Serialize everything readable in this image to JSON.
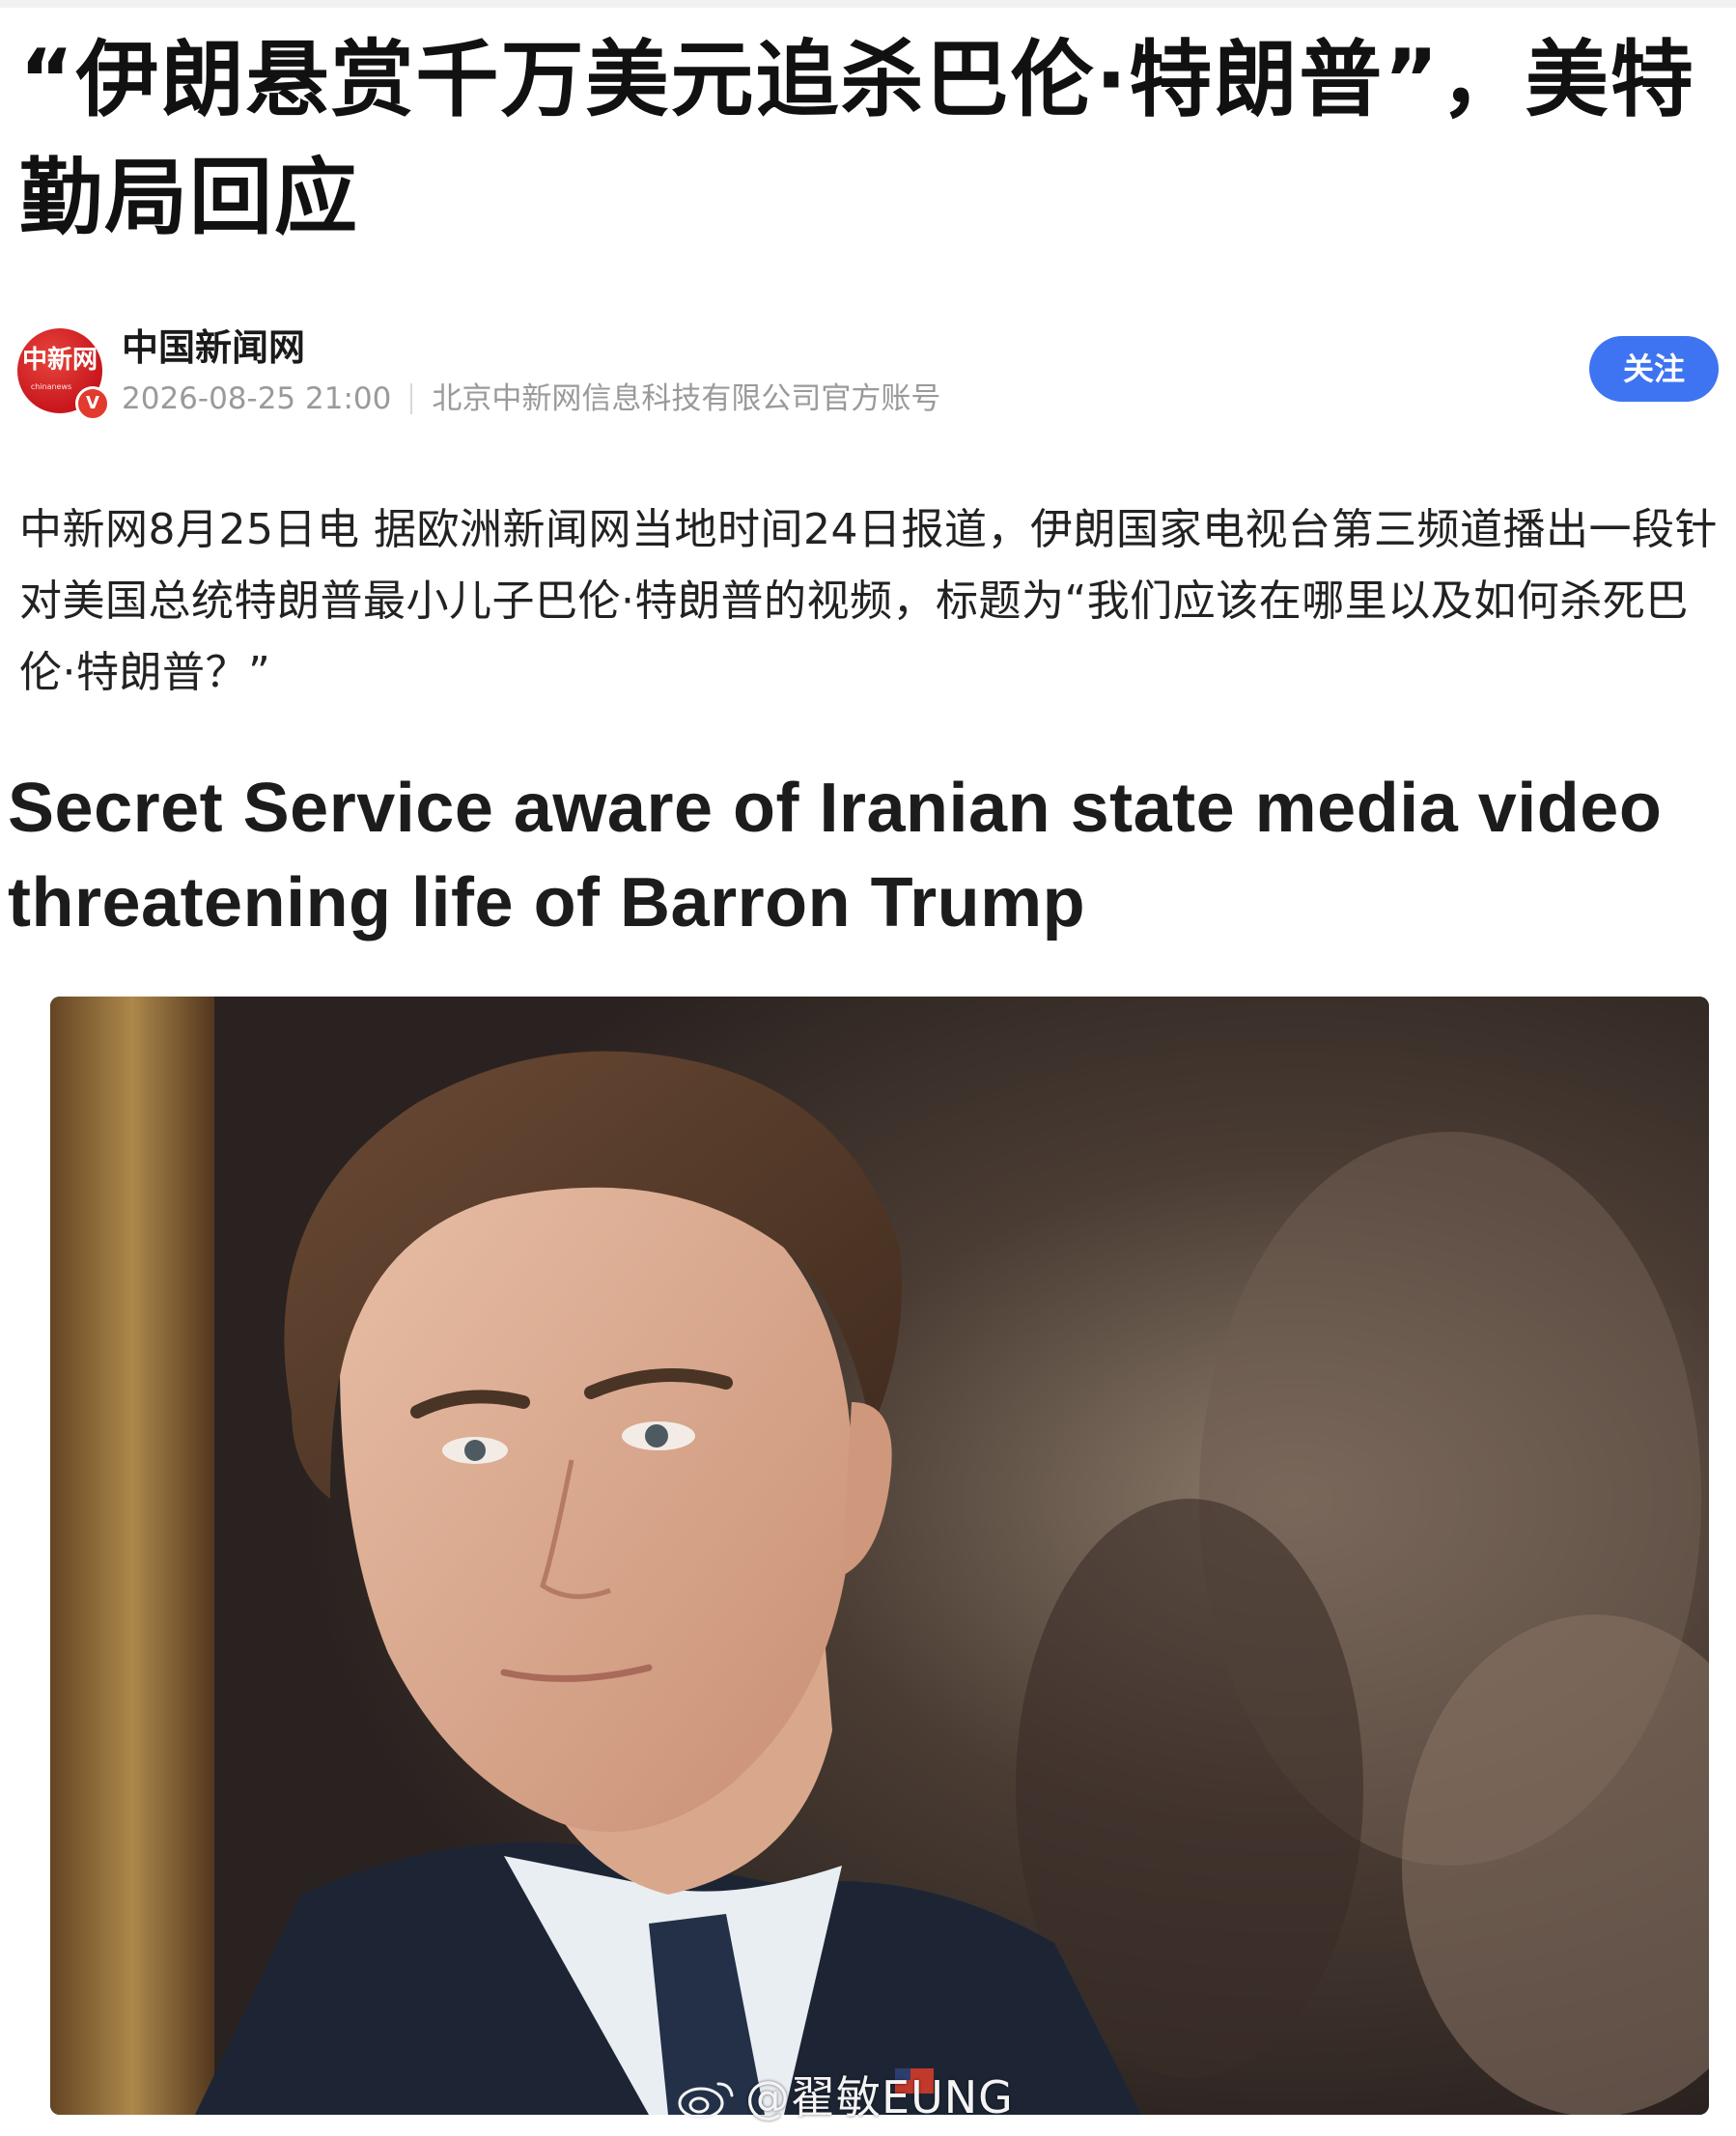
{
  "article": {
    "title": "“伊朗悬赏千万美元追杀巴伦·特朗普”，美特勤局回应",
    "body": "中新网8月25日电 据欧洲新闻网当地时间24日报道，伊朗国家电视台第三频道播出一段针对美国总统特朗普最小儿子巴伦·特朗普的视频，标题为“我们应该在哪里以及如何杀死巴伦·特朗普？”"
  },
  "author": {
    "name": "中国新闻网",
    "avatar_text": "中新网",
    "avatar_subtext": "chinanews",
    "verified_mark": "V",
    "timestamp": "2026-08-25 21:00",
    "description": "北京中新网信息科技有限公司官方账号",
    "follow_label": "关注"
  },
  "embedded_image": {
    "headline": "Secret Service aware of Iranian state media video threatening life of Barron Trump",
    "watermark": "@翟敏EUNG"
  },
  "colors": {
    "accent_blue": "#3e74f1",
    "brand_red": "#c8161d",
    "meta_gray": "#9a9a9a"
  }
}
